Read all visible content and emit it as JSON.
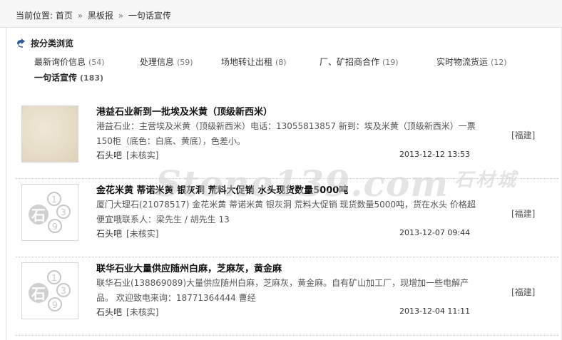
{
  "breadcrumb": {
    "label": "当前位置:",
    "items": [
      "首页",
      "黑板报",
      "一句话宣传"
    ],
    "separator": "»"
  },
  "category_section": {
    "title": "按分类浏览",
    "categories": [
      {
        "label": "最新询价信息",
        "count": "(54)"
      },
      {
        "label": "处理信息",
        "count": "(59)"
      },
      {
        "label": "场地转让出租",
        "count": "(8)"
      },
      {
        "label": "厂、矿招商合作",
        "count": "(19)"
      },
      {
        "label": "实时物流货运",
        "count": "(12)"
      },
      {
        "label": "一句话宣传",
        "count": "(183)",
        "active": true
      }
    ]
  },
  "posts": [
    {
      "title": "港益石业新到一批埃及米黄（顶级新西米）",
      "desc": "港益石业：主营埃及米黄（顶级新西米）电话：13055813857 新到：埃及米黄（顶级新西米）一票150柜（底色：白底、黄底），色差小。",
      "source": "石头吧",
      "status": "[未核实]",
      "date": "2013-12-12 13:53",
      "region": "[福建]",
      "thumb": "stone-image"
    },
    {
      "title": "金花米黄 蒂诺米黄 银灰洞 荒料大促销 水头现货数量5000吨",
      "desc": "厦门大理石(21078517) 金花米黄 蒂诺米黄 银灰洞 荒料大促销 现货数量5000吨，货在水头 价格超便宜哦联系人：梁先生 / 胡先生 13",
      "source": "石头吧",
      "status": "[未核实]",
      "date": "2013-12-07 09:44",
      "region": "[福建]",
      "thumb": "stone139-logo"
    },
    {
      "title": "联华石业大量供应随州白麻，芝麻灰，黄金麻",
      "desc": "联华石业(138869089)大量供应随州白麻，芝麻灰，黄金麻。自有矿山加工厂，现增加一些电解产品。 欢迎致电来询：18771364444 曹经",
      "source": "石头吧",
      "status": "[未核实]",
      "date": "2013-12-04 11:11",
      "region": "[福建]",
      "thumb": "stone139-logo"
    }
  ],
  "watermark": {
    "latin": "Stone139.com",
    "chinese": "石材城"
  },
  "colors": {
    "topbar": "#f7f7f7",
    "divider": "#cfcfcf",
    "logo_gray": "#c8c8c8"
  }
}
